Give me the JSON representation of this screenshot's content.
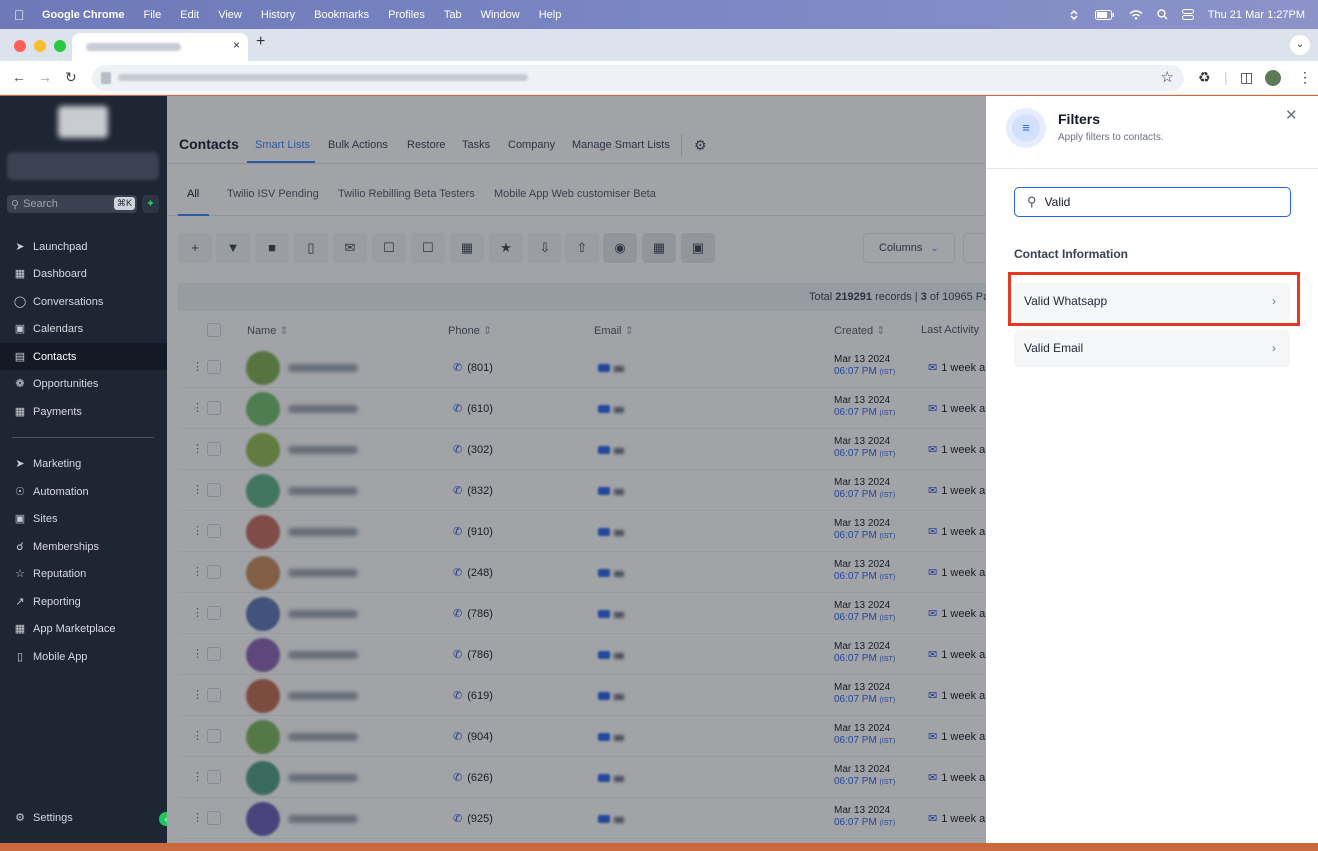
{
  "menubar": {
    "app": "Google Chrome",
    "items": [
      "File",
      "Edit",
      "View",
      "History",
      "Bookmarks",
      "Profiles",
      "Tab",
      "Window",
      "Help"
    ],
    "datetime": "Thu 21 Mar  1:27PM"
  },
  "browser": {
    "new_tab": "+",
    "close_tab": "×"
  },
  "sidebar": {
    "search_placeholder": "Search",
    "search_shortcut": "⌘K",
    "items": [
      {
        "label": "Launchpad",
        "icon": "rocket-icon"
      },
      {
        "label": "Dashboard",
        "icon": "grid-icon"
      },
      {
        "label": "Conversations",
        "icon": "chat-icon"
      },
      {
        "label": "Calendars",
        "icon": "calendar-icon"
      },
      {
        "label": "Contacts",
        "icon": "contacts-icon"
      },
      {
        "label": "Opportunities",
        "icon": "opportunities-icon"
      },
      {
        "label": "Payments",
        "icon": "payments-icon"
      },
      {
        "label": "Marketing",
        "icon": "send-icon"
      },
      {
        "label": "Automation",
        "icon": "automation-icon"
      },
      {
        "label": "Sites",
        "icon": "sites-icon"
      },
      {
        "label": "Memberships",
        "icon": "membership-icon"
      },
      {
        "label": "Reputation",
        "icon": "star-icon"
      },
      {
        "label": "Reporting",
        "icon": "reporting-icon"
      },
      {
        "label": "App Marketplace",
        "icon": "marketplace-icon"
      },
      {
        "label": "Mobile App",
        "icon": "mobile-icon"
      }
    ],
    "settings": "Settings"
  },
  "contacts": {
    "title": "Contacts",
    "tabs": [
      "Smart Lists",
      "Bulk Actions",
      "Restore",
      "Tasks",
      "Company",
      "Manage Smart Lists"
    ],
    "lists": [
      "All",
      "Twilio ISV Pending",
      "Twilio Rebilling Beta Testers",
      "Mobile App Web customiser Beta"
    ],
    "columns_button": "Columns",
    "total": {
      "prefix": "Total ",
      "count": "219291",
      "mid": " records | ",
      "page": "3",
      "suffix": " of 10965 Pa"
    },
    "headers": {
      "name": "Name",
      "phone": "Phone",
      "email": "Email",
      "created": "Created",
      "activity": "Last Activity"
    },
    "rows": [
      {
        "phone": "(801)",
        "date": "Mar 13 2024",
        "time": "06:07 PM",
        "tz": "(IST)",
        "activity": "1 week a",
        "color": "#7fae4e"
      },
      {
        "phone": "(610)",
        "date": "Mar 13 2024",
        "time": "06:07 PM",
        "tz": "(IST)",
        "activity": "1 week a",
        "color": "#6fbd6a"
      },
      {
        "phone": "(302)",
        "date": "Mar 13 2024",
        "time": "06:07 PM",
        "tz": "(IST)",
        "activity": "1 week a",
        "color": "#92bb4f"
      },
      {
        "phone": "(832)",
        "date": "Mar 13 2024",
        "time": "06:07 PM",
        "tz": "(IST)",
        "activity": "1 week a",
        "color": "#5cb083"
      },
      {
        "phone": "(910)",
        "date": "Mar 13 2024",
        "time": "06:07 PM",
        "tz": "(IST)",
        "activity": "1 week a",
        "color": "#c46a5c"
      },
      {
        "phone": "(248)",
        "date": "Mar 13 2024",
        "time": "06:07 PM",
        "tz": "(IST)",
        "activity": "1 week a",
        "color": "#c98a5a"
      },
      {
        "phone": "(786)",
        "date": "Mar 13 2024",
        "time": "06:07 PM",
        "tz": "(IST)",
        "activity": "1 week a",
        "color": "#5a74b5"
      },
      {
        "phone": "(786)",
        "date": "Mar 13 2024",
        "time": "06:07 PM",
        "tz": "(IST)",
        "activity": "1 week a",
        "color": "#8b63b6"
      },
      {
        "phone": "(619)",
        "date": "Mar 13 2024",
        "time": "06:07 PM",
        "tz": "(IST)",
        "activity": "1 week a",
        "color": "#c0694f"
      },
      {
        "phone": "(904)",
        "date": "Mar 13 2024",
        "time": "06:07 PM",
        "tz": "(IST)",
        "activity": "1 week a",
        "color": "#7db65a"
      },
      {
        "phone": "(626)",
        "date": "Mar 13 2024",
        "time": "06:07 PM",
        "tz": "(IST)",
        "activity": "1 week a",
        "color": "#4f9e82"
      },
      {
        "phone": "(925)",
        "date": "Mar 13 2024",
        "time": "06:07 PM",
        "tz": "(IST)",
        "activity": "1 week a",
        "color": "#6a5bb3"
      }
    ]
  },
  "filters": {
    "title": "Filters",
    "subtitle": "Apply filters to contacts.",
    "search_value": "Valid",
    "section": "Contact Information",
    "options": [
      "Valid Whatsapp",
      "Valid Email"
    ],
    "highlight_color": "#e53925",
    "accent_color": "#2563eb"
  }
}
